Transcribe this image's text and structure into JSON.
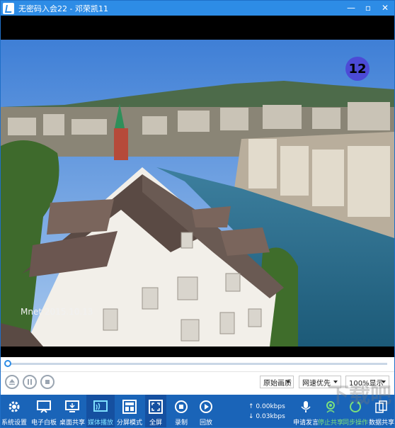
{
  "window": {
    "title": "无密码入会22 - 邓荣凯11",
    "controls": {
      "minimize": "—",
      "maximize": "▫",
      "close": "✕"
    }
  },
  "video": {
    "counter": "12",
    "watermark": "Mnet 2015.10.13"
  },
  "playback": {
    "progress_fraction": 0.0,
    "quality": "原始画质",
    "network": "网速优先",
    "zoom": "100%显示"
  },
  "toolbar": {
    "items": [
      {
        "label": "系统设置",
        "icon": "gear-icon"
      },
      {
        "label": "电子白板",
        "icon": "whiteboard-icon"
      },
      {
        "label": "桌面共享",
        "icon": "desktop-share-icon"
      },
      {
        "label": "媒体播放",
        "icon": "media-play-icon"
      },
      {
        "label": "分屏模式",
        "icon": "split-screen-icon"
      },
      {
        "label": "全屏",
        "icon": "fullscreen-icon"
      },
      {
        "label": "录制",
        "icon": "record-icon"
      },
      {
        "label": "回放",
        "icon": "playback-icon"
      },
      {
        "label": "申请发言",
        "icon": "microphone-icon"
      },
      {
        "label": "停止共享",
        "icon": "stop-share-icon"
      },
      {
        "label": "同步操作",
        "icon": "sync-icon"
      },
      {
        "label": "数据共享",
        "icon": "data-share-icon"
      }
    ],
    "upload_speed": "↑ 0.00kbps",
    "download_speed": "↓ 0.03kbps"
  },
  "brand_watermark": "下载吧",
  "colors": {
    "titlebar": "#2d8ce6",
    "toolbar": "#1a64b8",
    "counter_badge": "#4c4bd6"
  }
}
